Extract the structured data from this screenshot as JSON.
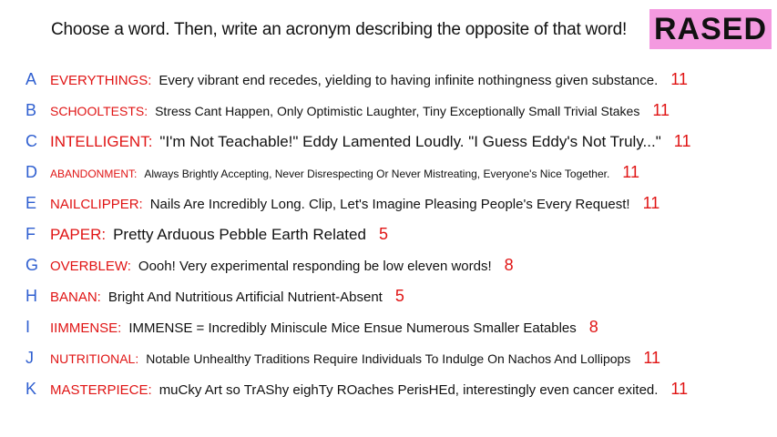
{
  "prompt": "Choose a word. Then, write an acronym describing the opposite of that word!",
  "badge": "RASED",
  "colors": {
    "badge_bg": "#f49ae0",
    "letter": "#2f5fd0",
    "word": "#e01414",
    "count": "#e01414",
    "text": "#111111"
  },
  "entries": [
    {
      "letter": "A",
      "word": "EVERYTHINGS:",
      "acronym": "Every vibrant end recedes, yielding to having infinite nothingness given substance.",
      "count": "11"
    },
    {
      "letter": "B",
      "word": "SCHOOLTESTS:",
      "acronym": "Stress Cant Happen, Only Optimistic Laughter, Tiny Exceptionally Small Trivial Stakes",
      "count": "11"
    },
    {
      "letter": "C",
      "word": "INTELLIGENT:",
      "acronym": "\"I'm Not Teachable!\" Eddy Lamented Loudly. \"I Guess Eddy's Not Truly...\"",
      "count": "11"
    },
    {
      "letter": "D",
      "word": "ABANDONMENT:",
      "acronym": "Always Brightly Accepting, Never Disrespecting Or Never Mistreating, Everyone's Nice Together.",
      "count": "11"
    },
    {
      "letter": "E",
      "word": "NAILCLIPPER:",
      "acronym": "Nails Are Incredibly Long. Clip, Let's Imagine Pleasing People's Every Request!",
      "count": "11"
    },
    {
      "letter": "F",
      "word": "PAPER:",
      "acronym": "Pretty Arduous Pebble Earth Related",
      "count": "5"
    },
    {
      "letter": "G",
      "word": "OVERBLEW:",
      "acronym": "Oooh! Very experimental responding be low eleven words!",
      "count": "8"
    },
    {
      "letter": "H",
      "word": "BANAN:",
      "acronym": "Bright And Nutritious Artificial Nutrient-Absent",
      "count": "5"
    },
    {
      "letter": "I",
      "word": "IIMMENSE:",
      "acronym": "IMMENSE = Incredibly Miniscule Mice Ensue Numerous Smaller Eatables",
      "count": "8"
    },
    {
      "letter": "J",
      "word": "NUTRITIONAL:",
      "acronym": "Notable Unhealthy Traditions Require Individuals To Indulge On Nachos And Lollipops",
      "count": "11"
    },
    {
      "letter": "K",
      "word": "MASTERPIECE:",
      "acronym": "muCky Art so TrAShy eighTy ROaches PerisHEd, interestingly even cancer exited.",
      "count": "11"
    }
  ]
}
